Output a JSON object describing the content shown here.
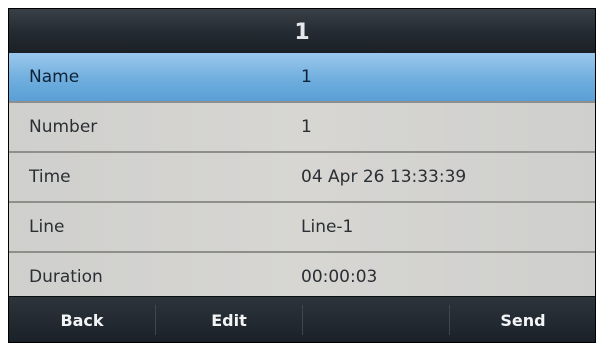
{
  "title": "1",
  "fields": [
    {
      "label": "Name",
      "value": "1",
      "selected": true
    },
    {
      "label": "Number",
      "value": "1",
      "selected": false
    },
    {
      "label": "Time",
      "value": "04 Apr 26 13:33:39",
      "selected": false
    },
    {
      "label": "Line",
      "value": "Line-1",
      "selected": false
    },
    {
      "label": "Duration",
      "value": "00:00:03",
      "selected": false
    }
  ],
  "softkeys": {
    "back": "Back",
    "edit": "Edit",
    "empty": "",
    "send": "Send"
  },
  "colors": {
    "selected_row": "#6faede",
    "row_background": "#d3d3d0",
    "title_bar": "#232a31",
    "softkey_bar": "#1b2128"
  }
}
